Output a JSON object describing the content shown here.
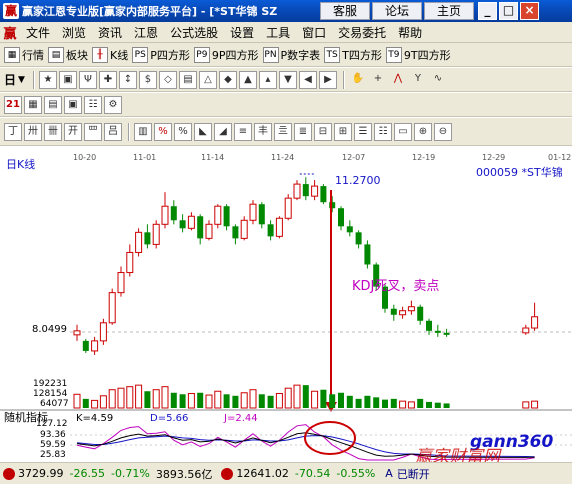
{
  "window": {
    "title": "赢家江恩专业版[赢家内部服务平台] - [*ST华锦 SZ",
    "links": [
      "客服",
      "论坛",
      "主页"
    ],
    "controls": [
      "_",
      "□",
      "×"
    ]
  },
  "menu": {
    "items": [
      "文件",
      "浏览",
      "资讯",
      "江恩",
      "公式选股",
      "设置",
      "工具",
      "窗口",
      "交易委托",
      "帮助"
    ]
  },
  "toolbar1": {
    "buttons": [
      {
        "label": "行情",
        "icon": "grid-icon"
      },
      {
        "label": "板块",
        "icon": "blocks-icon"
      },
      {
        "label": "K线",
        "icon": "candle-icon"
      },
      {
        "label": "P四方形",
        "icon": "PS"
      },
      {
        "label": "9P四方形",
        "icon": "P9"
      },
      {
        "label": "P数字表",
        "icon": "PN"
      },
      {
        "label": "T四方形",
        "icon": "TS"
      },
      {
        "label": "9T四方形",
        "icon": "T9"
      }
    ]
  },
  "toolbar2": {
    "period": "日",
    "buttons": [
      "★",
      "▣",
      "Ψ",
      "✚",
      "↕",
      "$",
      "◇",
      "▤",
      "△",
      "◆",
      "▲",
      "▴",
      "▼",
      "◀",
      "▶"
    ]
  },
  "toolbar3": {
    "buttons": [
      "21",
      "▦",
      "▤",
      "▣",
      "☷",
      "⚙"
    ]
  },
  "toolbar4": {
    "buttons": [
      "丁",
      "卅",
      "卌",
      "开",
      "罒",
      "吕",
      "▥",
      "%",
      "%",
      "◣",
      "◢",
      "≡",
      "丰",
      "亖",
      "≣",
      "⊟",
      "⊞",
      "☰",
      "☷",
      "▭",
      "⊕",
      "⊖"
    ]
  },
  "chart": {
    "period_label": "日K线",
    "stock_label": "000059 *ST华锦",
    "dates": [
      "10-20",
      "11-01",
      "11-14",
      "11-24",
      "12-07",
      "12-19",
      "12-29",
      "01-12"
    ],
    "high_label": "11.2700",
    "price_label": "8.0499",
    "annotation": "KDJ死叉，卖点",
    "volume_labels": [
      "192231",
      "128154",
      "64077"
    ],
    "indicator_title": "随机指标",
    "k_label": "K=4.59",
    "d_label": "D=5.66",
    "j_label": "J=2.44",
    "indicator_scale": [
      "127.12",
      "93.36",
      "59.59",
      "25.83"
    ],
    "watermark_top": "gann360",
    "watermark_bottom": "赢家财富网",
    "colors": {
      "up": "#cc0000",
      "down": "#008800",
      "k_line": "#000000",
      "d_line": "#1515c8",
      "j_line": "#c000c0",
      "annotation": "#c000c0",
      "arrow": "#cc0000"
    }
  },
  "chart_data": {
    "type": "candlestick",
    "title": "",
    "xlabel": "",
    "ylabel": "",
    "candles": [
      {
        "o": 7.35,
        "c": 7.45,
        "h": 7.6,
        "l": 7.2
      },
      {
        "o": 7.2,
        "c": 6.95,
        "h": 7.25,
        "l": 6.9
      },
      {
        "o": 6.95,
        "c": 7.2,
        "h": 7.3,
        "l": 6.85
      },
      {
        "o": 7.2,
        "c": 7.65,
        "h": 7.75,
        "l": 7.1
      },
      {
        "o": 7.65,
        "c": 8.4,
        "h": 8.5,
        "l": 7.6
      },
      {
        "o": 8.4,
        "c": 8.9,
        "h": 9.05,
        "l": 8.3
      },
      {
        "o": 8.9,
        "c": 9.4,
        "h": 9.6,
        "l": 8.8
      },
      {
        "o": 9.4,
        "c": 9.9,
        "h": 10.0,
        "l": 9.3
      },
      {
        "o": 9.9,
        "c": 9.6,
        "h": 10.1,
        "l": 9.5
      },
      {
        "o": 9.6,
        "c": 10.1,
        "h": 10.2,
        "l": 9.5
      },
      {
        "o": 10.1,
        "c": 10.55,
        "h": 10.9,
        "l": 10.0
      },
      {
        "o": 10.55,
        "c": 10.2,
        "h": 10.7,
        "l": 10.1
      },
      {
        "o": 10.2,
        "c": 10.0,
        "h": 10.35,
        "l": 9.9
      },
      {
        "o": 10.0,
        "c": 10.3,
        "h": 10.4,
        "l": 9.95
      },
      {
        "o": 10.3,
        "c": 9.75,
        "h": 10.35,
        "l": 9.6
      },
      {
        "o": 9.75,
        "c": 10.1,
        "h": 10.2,
        "l": 9.7
      },
      {
        "o": 10.1,
        "c": 10.55,
        "h": 10.6,
        "l": 10.0
      },
      {
        "o": 10.55,
        "c": 10.05,
        "h": 10.6,
        "l": 9.95
      },
      {
        "o": 10.05,
        "c": 9.75,
        "h": 10.1,
        "l": 9.6
      },
      {
        "o": 9.75,
        "c": 10.2,
        "h": 10.3,
        "l": 9.7
      },
      {
        "o": 10.2,
        "c": 10.6,
        "h": 10.7,
        "l": 10.1
      },
      {
        "o": 10.6,
        "c": 10.1,
        "h": 10.65,
        "l": 10.0
      },
      {
        "o": 10.1,
        "c": 9.8,
        "h": 10.2,
        "l": 9.7
      },
      {
        "o": 9.8,
        "c": 10.25,
        "h": 10.3,
        "l": 9.75
      },
      {
        "o": 10.25,
        "c": 10.75,
        "h": 10.85,
        "l": 10.2
      },
      {
        "o": 10.75,
        "c": 11.1,
        "h": 11.2,
        "l": 10.7
      },
      {
        "o": 11.1,
        "c": 10.8,
        "h": 11.27,
        "l": 10.7
      },
      {
        "o": 10.8,
        "c": 11.05,
        "h": 11.2,
        "l": 10.7
      },
      {
        "o": 11.05,
        "c": 10.65,
        "h": 11.1,
        "l": 10.6
      },
      {
        "o": 10.65,
        "c": 10.5,
        "h": 10.8,
        "l": 10.4
      },
      {
        "o": 10.5,
        "c": 10.05,
        "h": 10.55,
        "l": 9.95
      },
      {
        "o": 10.05,
        "c": 9.9,
        "h": 10.2,
        "l": 9.8
      },
      {
        "o": 9.9,
        "c": 9.6,
        "h": 9.95,
        "l": 9.5
      },
      {
        "o": 9.6,
        "c": 9.1,
        "h": 9.7,
        "l": 9.0
      },
      {
        "o": 9.1,
        "c": 8.55,
        "h": 9.15,
        "l": 8.45
      },
      {
        "o": 8.55,
        "c": 8.0,
        "h": 8.6,
        "l": 7.9
      },
      {
        "o": 8.0,
        "c": 7.85,
        "h": 8.1,
        "l": 7.7
      },
      {
        "o": 7.85,
        "c": 7.95,
        "h": 8.05,
        "l": 7.75
      },
      {
        "o": 7.95,
        "c": 8.05,
        "h": 8.2,
        "l": 7.85
      },
      {
        "o": 8.05,
        "c": 7.7,
        "h": 8.1,
        "l": 7.6
      },
      {
        "o": 7.7,
        "c": 7.45,
        "h": 7.75,
        "l": 7.35
      },
      {
        "o": 7.45,
        "c": 7.4,
        "h": 7.6,
        "l": 7.3
      },
      {
        "o": 7.4,
        "c": 7.35,
        "h": 7.5,
        "l": 7.3
      },
      {
        "o": 7.4,
        "c": 7.52,
        "h": 7.6,
        "l": 7.35
      },
      {
        "o": 7.52,
        "c": 7.8,
        "h": 8.15,
        "l": 7.45
      }
    ],
    "candle_gaps_after": [
      42
    ],
    "ylim": [
      6.6,
      11.6
    ],
    "volume": [
      90,
      60,
      50,
      80,
      120,
      130,
      140,
      150,
      110,
      120,
      140,
      100,
      90,
      95,
      100,
      85,
      110,
      90,
      80,
      100,
      120,
      90,
      80,
      95,
      130,
      150,
      150,
      110,
      120,
      90,
      100,
      80,
      60,
      80,
      70,
      55,
      60,
      45,
      40,
      60,
      40,
      35,
      30,
      40,
      45
    ],
    "volume_ylim": [
      0,
      210
    ],
    "kdj": {
      "K": [
        52,
        48,
        44,
        50,
        60,
        72,
        80,
        85,
        78,
        80,
        83,
        72,
        64,
        66,
        58,
        60,
        68,
        62,
        54,
        62,
        72,
        63,
        55,
        62,
        74,
        86,
        90,
        84,
        78,
        66,
        55,
        45,
        34,
        22,
        12,
        8,
        9,
        12,
        16,
        12,
        8,
        6,
        5,
        4,
        5
      ],
      "D": [
        55,
        52,
        49,
        49,
        53,
        59,
        66,
        72,
        74,
        76,
        78,
        76,
        72,
        70,
        66,
        64,
        65,
        64,
        61,
        61,
        65,
        64,
        61,
        61,
        65,
        72,
        78,
        80,
        79,
        75,
        68,
        60,
        51,
        41,
        31,
        23,
        18,
        16,
        16,
        15,
        13,
        11,
        9,
        7,
        6
      ],
      "J": [
        46,
        40,
        34,
        52,
        74,
        98,
        108,
        111,
        86,
        88,
        93,
        64,
        48,
        58,
        42,
        52,
        74,
        58,
        40,
        64,
        86,
        61,
        43,
        64,
        92,
        114,
        118,
        92,
        76,
        48,
        29,
        15,
        0,
        -16,
        -26,
        -22,
        -9,
        4,
        16,
        6,
        -2,
        -4,
        -3,
        -2,
        3
      ],
      "ylim": [
        -5,
        127.12
      ]
    }
  },
  "status": {
    "index1": "3729.99",
    "change1": "-26.55",
    "pct1": "-0.71%",
    "amount1": "3893.56亿",
    "index2": "12641.02",
    "change2": "-70.54",
    "pct2": "-0.55%",
    "flag": "A",
    "conn": "已断开"
  }
}
